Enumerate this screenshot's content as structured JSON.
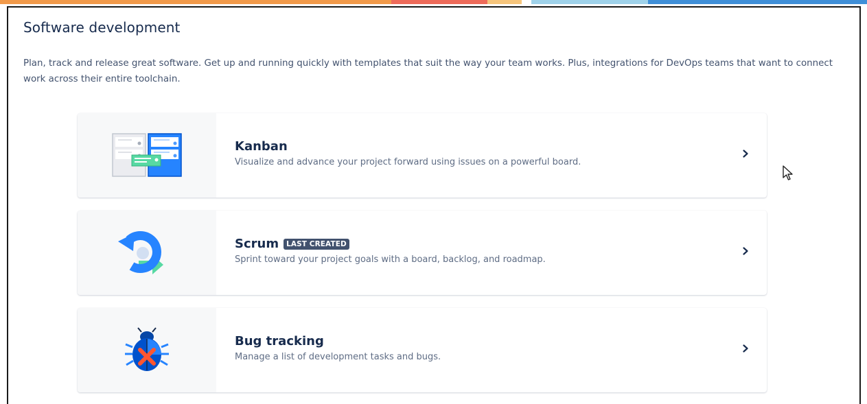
{
  "section": {
    "title": "Software development",
    "description": "Plan, track and release great software. Get up and running quickly with templates that suit the way your team works. Plus, integrations for DevOps teams that want to connect work across their entire toolchain."
  },
  "templates": [
    {
      "name": "Kanban",
      "badge": "",
      "description": "Visualize and advance your project forward using issues on a powerful board.",
      "illustration": "kanban-board-illustration"
    },
    {
      "name": "Scrum",
      "badge": "LAST CREATED",
      "description": "Sprint toward your project goals with a board, backlog, and roadmap.",
      "illustration": "scrum-sprint-arrow-illustration"
    },
    {
      "name": "Bug tracking",
      "badge": "",
      "description": "Manage a list of development tasks and bugs.",
      "illustration": "bug-icon-illustration"
    }
  ],
  "colors": {
    "title": "#172b4d",
    "description": "#42526e",
    "badge_bg": "#42526e",
    "illustration_blue": "#2684ff",
    "illustration_green": "#57d9a3"
  }
}
